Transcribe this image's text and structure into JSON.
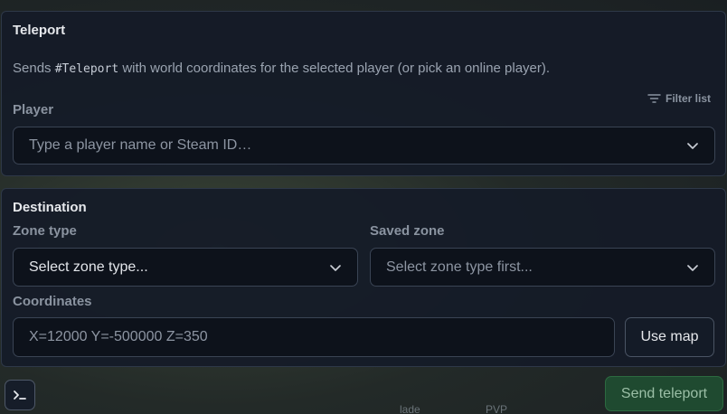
{
  "teleport": {
    "title": "Teleport",
    "desc_prefix": "Sends ",
    "desc_command": "#Teleport",
    "desc_suffix": " with world coordinates for the selected player (or pick an online player).",
    "player_label": "Player",
    "filter_label": "Filter list",
    "player_placeholder": "Type a player name or Steam ID…"
  },
  "destination": {
    "title": "Destination",
    "zone_type_label": "Zone type",
    "zone_type_value": "Select zone type...",
    "saved_zone_label": "Saved zone",
    "saved_zone_placeholder": "Select zone type first...",
    "coordinates_label": "Coordinates",
    "coordinates_placeholder": "X=12000 Y=-500000 Z=350",
    "use_map_label": "Use map"
  },
  "footer": {
    "send_label": "Send teleport",
    "background_text": [
      "lade",
      "PVP"
    ]
  },
  "icons": {
    "filter": "filter-icon",
    "chevron": "chevron-down-icon",
    "terminal": "terminal-icon"
  }
}
